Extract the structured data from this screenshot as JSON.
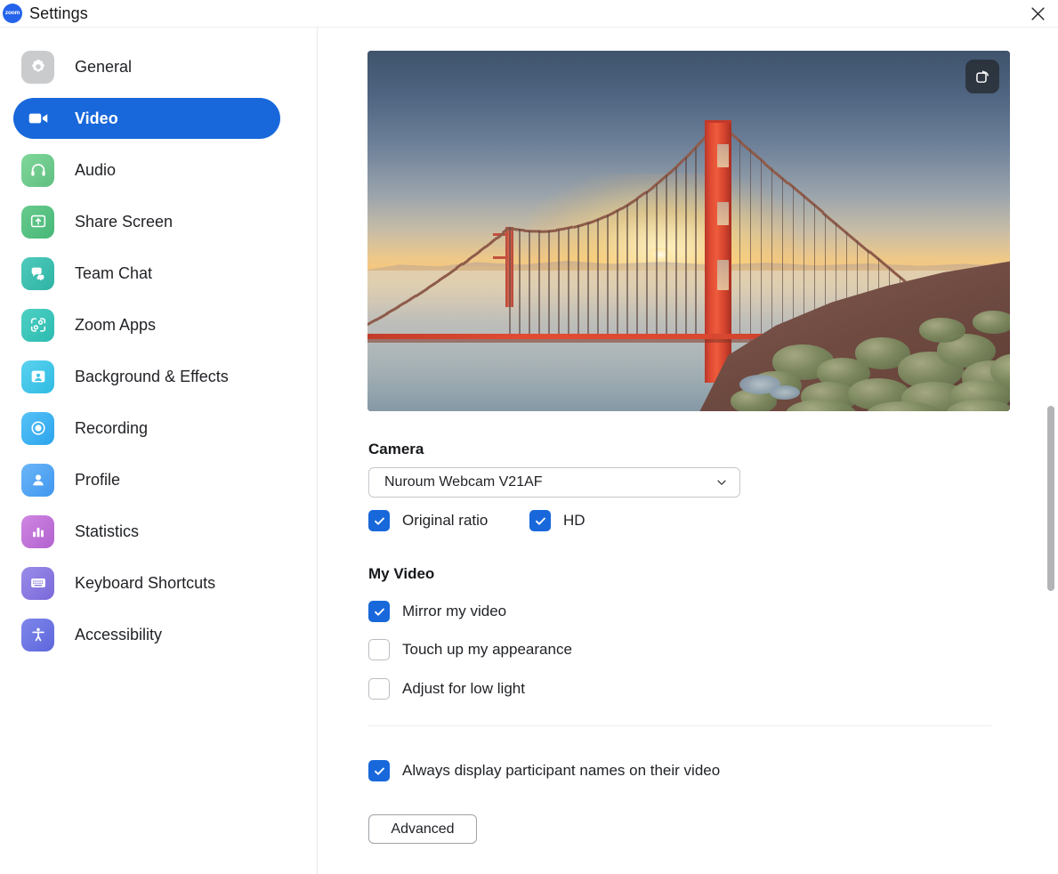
{
  "window": {
    "title": "Settings",
    "logo_text": "zoom",
    "close_label": "×"
  },
  "sidebar": {
    "items": [
      {
        "label": "General",
        "icon": "gear-icon",
        "color": "#c9cbcd",
        "active": false
      },
      {
        "label": "Video",
        "icon": "video-camera-icon",
        "color": "#1868db",
        "active": true
      },
      {
        "label": "Audio",
        "icon": "headphones-icon",
        "color": "#6fc98a",
        "active": false
      },
      {
        "label": "Share Screen",
        "icon": "share-screen-icon",
        "color": "#55bf84",
        "active": false
      },
      {
        "label": "Team Chat",
        "icon": "chat-bubble-icon",
        "color": "#3ebfab",
        "active": false
      },
      {
        "label": "Zoom Apps",
        "icon": "zoom-apps-icon",
        "color": "#3cc3b6",
        "active": false
      },
      {
        "label": "Background & Effects",
        "icon": "person-frame-icon",
        "color": "#43c5e8",
        "active": false
      },
      {
        "label": "Recording",
        "icon": "record-circle-icon",
        "color": "#3fb3f0",
        "active": false
      },
      {
        "label": "Profile",
        "icon": "person-icon",
        "color": "#5aa9f2",
        "active": false
      },
      {
        "label": "Statistics",
        "icon": "bar-chart-icon",
        "color": "#c479d8",
        "active": false
      },
      {
        "label": "Keyboard Shortcuts",
        "icon": "keyboard-icon",
        "color": "#8d7fe0",
        "active": false
      },
      {
        "label": "Accessibility",
        "icon": "accessibility-icon",
        "color": "#6f78e2",
        "active": false
      }
    ]
  },
  "main": {
    "video_preview": {
      "rotate_button_label": "rotate-camera",
      "scene": "Golden Gate Bridge at sunset"
    },
    "camera": {
      "heading": "Camera",
      "selected_device": "Nuroum Webcam V21AF",
      "options": [
        {
          "label": "Original ratio",
          "checked": true
        },
        {
          "label": "HD",
          "checked": true
        }
      ]
    },
    "my_video": {
      "heading": "My Video",
      "options": [
        {
          "label": "Mirror my video",
          "checked": true
        },
        {
          "label": "Touch up my appearance",
          "checked": false
        },
        {
          "label": "Adjust for low light",
          "checked": false
        }
      ]
    },
    "participant_names": {
      "label": "Always display participant names on their video",
      "checked": true
    },
    "advanced_button": "Advanced"
  },
  "colors": {
    "accent": "#1868db",
    "text": "#1f2125",
    "border": "#c5c8cc"
  }
}
